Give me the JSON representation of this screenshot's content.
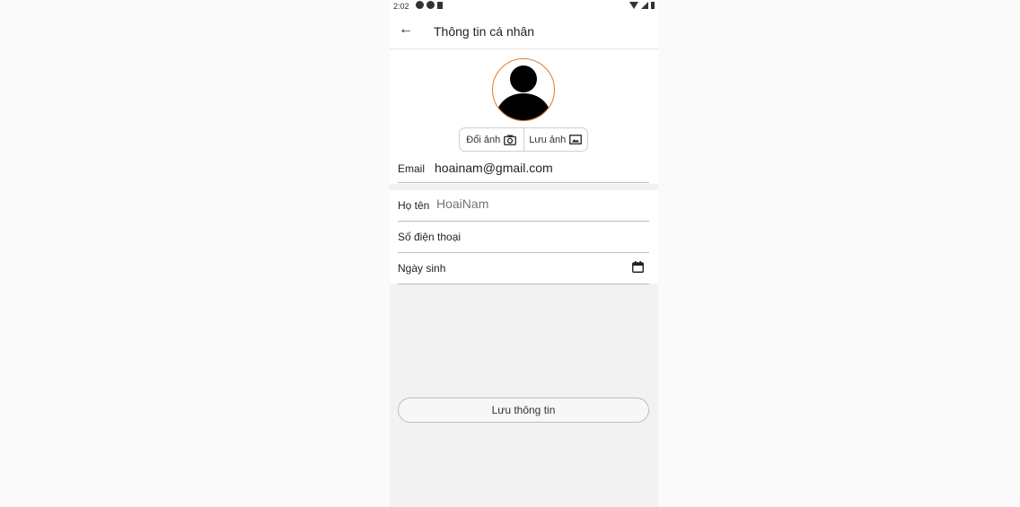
{
  "status_bar": {
    "time": "2:02"
  },
  "toolbar": {
    "title": "Thông tin cá nhân"
  },
  "profile": {
    "change_photo_label": "Đổi ảnh",
    "save_photo_label": "Lưu ảnh",
    "email_label": "Email",
    "email_value": "hoainam@gmail.com"
  },
  "form": {
    "name_label": "Họ tên",
    "name_placeholder": "HoaiNam",
    "phone_label": "Số điện thoại",
    "birthday_label": "Ngày sinh"
  },
  "actions": {
    "save_info_label": "Lưu thông tin"
  },
  "colors": {
    "avatar_border": "#e07a2c",
    "page_bg": "#f2f2f2",
    "card_bg": "#ffffff"
  }
}
